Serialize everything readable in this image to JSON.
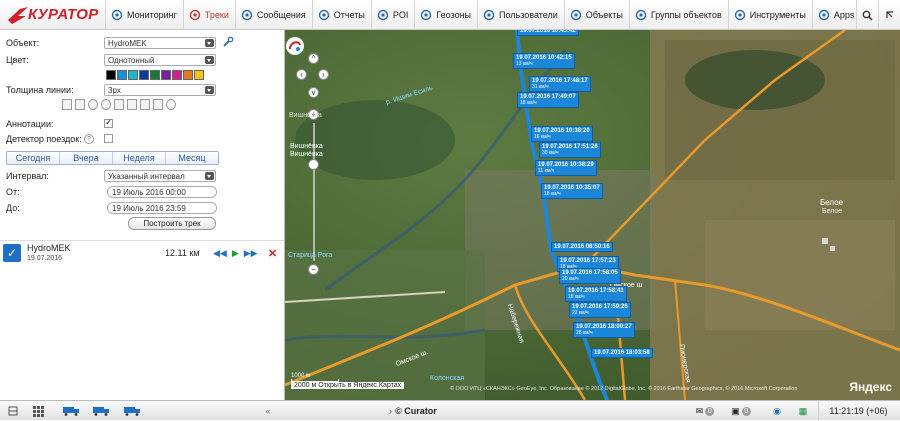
{
  "app": {
    "logo": "КУРАТОР"
  },
  "nav": [
    {
      "label": "Мониторинг",
      "icon": "globe-icon",
      "active": false
    },
    {
      "label": "Треки",
      "icon": "track-icon",
      "active": true
    },
    {
      "label": "Сообщения",
      "icon": "table-icon",
      "active": false
    },
    {
      "label": "Отчеты",
      "icon": "report-icon",
      "active": false
    },
    {
      "label": "POI",
      "icon": "poi-icon",
      "active": false
    },
    {
      "label": "Геозоны",
      "icon": "geofence-icon",
      "active": false
    },
    {
      "label": "Пользователи",
      "icon": "users-icon",
      "active": false
    },
    {
      "label": "Объекты",
      "icon": "objects-icon",
      "active": false
    },
    {
      "label": "Группы объектов",
      "icon": "groups-icon",
      "active": false
    },
    {
      "label": "Инструменты",
      "icon": "tools-icon",
      "active": false
    },
    {
      "label": "Apps",
      "icon": "apps-icon",
      "active": false
    }
  ],
  "form": {
    "object_label": "Объект:",
    "object_value": "HydroMEK",
    "color_label": "Цвет:",
    "color_value": "Однотонный",
    "swatches": [
      "#000000",
      "#1a8fd6",
      "#17b6c9",
      "#0e3a9e",
      "#1a7a3a",
      "#7a1fa2",
      "#d61f8c",
      "#e07a1a",
      "#f2c318"
    ],
    "thickness_label": "Толщина линии:",
    "thickness_value": "3px",
    "annotations_label": "Аннотации:",
    "detector_label": "Детектор поездок:",
    "periods": [
      "Сегодня",
      "Вчера",
      "Неделя",
      "Месяц"
    ],
    "interval_label": "Интервал:",
    "interval_value": "Указанный интервал",
    "from_label": "От:",
    "from_value": "19 Июль 2016 00:00",
    "to_label": "До:",
    "to_value": "19 Июль 2016 23:59",
    "build_button": "Построить трек"
  },
  "track": {
    "name": "HydroMEK",
    "date": "19.07.2016",
    "distance": "12.11 км"
  },
  "map": {
    "labels": [
      {
        "time": "19.07.2016 10:43:42",
        "speed": ""
      },
      {
        "time": "19.07.2016 10:42:15",
        "speed": "13 км/ч"
      },
      {
        "time": "19.07.2016 17:48:17",
        "speed": "31 км/ч"
      },
      {
        "time": "19.07.2016 17:49:07",
        "speed": "18 км/ч"
      },
      {
        "time": "19.07.2016 10:38:20",
        "speed": "16 км/ч"
      },
      {
        "time": "19.07.2016 17:51:26",
        "speed": "30 км/ч"
      },
      {
        "time": "19.07.2016 10:38:29",
        "speed": "11 км/ч"
      },
      {
        "time": "19.07.2016 10:35:07",
        "speed": "18 км/ч"
      },
      {
        "time": "19.07.2016 08:50:16",
        "speed": ""
      },
      {
        "time": "19.07.2016 17:57:23",
        "speed": "18 км/ч"
      },
      {
        "time": "19.07.2016 17:58:05",
        "speed": "20 км/ч"
      },
      {
        "time": "19.07.2016 17:58:41",
        "speed": "18 км/ч"
      },
      {
        "time": "19.07.2016 17:59:26",
        "speed": "22 км/ч"
      },
      {
        "time": "19.07.2016 18:00:27",
        "speed": "28 км/ч"
      },
      {
        "time": "19.07.2016 18:03:58",
        "speed": ""
      }
    ],
    "place_belo": "Белое",
    "place_belo2": "Белое",
    "place_vishnyovka": "Вишнёвка",
    "place_vishnyovka2": "Вишнёвка",
    "river": "р. Иша",
    "river2": "р. Ишим Есиль",
    "staritsa": "Старица Рога",
    "road_omskoe": "Омское ш.",
    "road_omskoe2": "Омское ш",
    "road_naberezhnaya": "Набережная",
    "road_kolonskaya": "Колонская",
    "road_pionerskaya": "Пионерская",
    "copyright": "© ООО ИТЦ «СКАНЭКС» GeoEye, Inc. Образование © 2012 DigitalGlobe, Inc. © 2016 Earthstar Geographics, © 2016 Microsoft Corporation",
    "open_in": "Открыть в Яндекс.Картах",
    "scale": "2000 м",
    "scale_small": "1000 м",
    "yandex": "Яндекс"
  },
  "bottom": {
    "brand": "© Curator",
    "badge1": "0",
    "badge2": "0",
    "badge3": "0",
    "clock": "11:21:19 (+06)"
  },
  "colors": {
    "accent": "#c0392b",
    "track": "#1c86d8",
    "road": "#e89a2a"
  }
}
